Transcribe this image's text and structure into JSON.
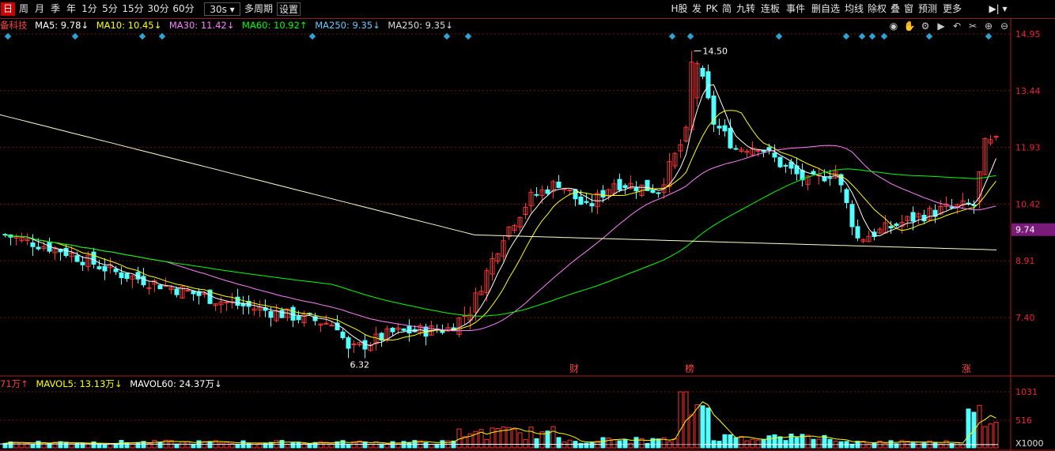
{
  "toolbar": {
    "left": [
      "日",
      "周",
      "月",
      "季",
      "年",
      "1分",
      "5分",
      "15分",
      "30分",
      "60分"
    ],
    "period_select": "30s",
    "multi_period": "多周期",
    "settings": "设置",
    "right": [
      "H股",
      "发",
      "PK",
      "简",
      "九转",
      "连板",
      "事件",
      "删自选",
      "均线",
      "除权",
      "叠",
      "窗",
      "预测",
      "更多"
    ]
  },
  "indicators": {
    "name": "备科技",
    "ma5": "MA5: 9.78↓",
    "ma10": "MA10: 10.45↓",
    "ma30": "MA30: 11.42↓",
    "ma60": "MA60: 10.92↑",
    "ma250": "MA250: 9.35↓",
    "ma250b": "MA250: 9.35↓"
  },
  "volume_indicators": {
    "vol": "71万↑",
    "mavol5": "MAVOL5: 13.13万↓",
    "mavol60": "MAVOL60: 24.37万↓"
  },
  "price_axis": [
    "14.95",
    "13.44",
    "11.93",
    "10.42",
    "8.91",
    "7.40"
  ],
  "current_price": "9.74",
  "high_label": "14.50",
  "low_label": "6.32",
  "event_markers": [
    "财",
    "榜",
    "涨"
  ],
  "vol_axis": [
    "1031",
    "516",
    "X1000"
  ],
  "colors": {
    "up": "#ff3232",
    "down": "#54ffff",
    "ma5": "#ffffff",
    "ma10": "#ffff00",
    "ma30": "#ff80ff",
    "ma60": "#00ff00",
    "ma250": "#ffffcc"
  }
}
